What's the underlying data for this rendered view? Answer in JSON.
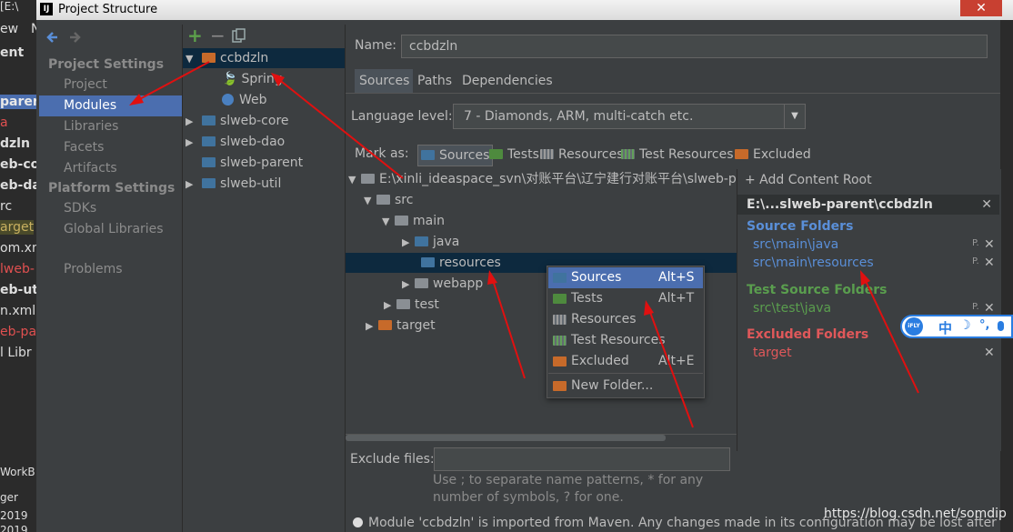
{
  "window": {
    "title": "Project Structure",
    "close_glyph": "✕",
    "app_icon": "IJ"
  },
  "background_ide": {
    "rows": [
      "[E:\\",
      "ew",
      "ent",
      "parer",
      "a",
      "dzln",
      "eb-co",
      "eb-da",
      "rc",
      "arget",
      "om.xn",
      "lweb-",
      "eb-uti",
      "n.xml",
      "eb-pa",
      "l Libr",
      "WorkB",
      "ger",
      "2019",
      "2019"
    ],
    "tab_label": "N"
  },
  "nav": {
    "back_icon": "arrow-left-icon",
    "forward_icon": "arrow-right-icon",
    "project_settings_header": "Project Settings",
    "project_settings": [
      "Project",
      "Modules",
      "Libraries",
      "Facets",
      "Artifacts"
    ],
    "platform_settings_header": "Platform Settings",
    "platform_settings": [
      "SDKs",
      "Global Libraries"
    ],
    "problems": "Problems",
    "selected": "Modules"
  },
  "modules": {
    "toolbar": [
      "add-icon",
      "remove-icon",
      "copy-icon"
    ],
    "add_glyph": "+",
    "remove_glyph": "−",
    "tree": [
      {
        "label": "ccbdzln",
        "expanded": true,
        "selected": true
      },
      {
        "label": "Spring",
        "child": true
      },
      {
        "label": "Web",
        "child": true
      },
      {
        "label": "slweb-core",
        "expanded": false
      },
      {
        "label": "slweb-dao",
        "expanded": false
      },
      {
        "label": "slweb-parent",
        "expanded": false
      },
      {
        "label": "slweb-util",
        "expanded": false
      }
    ]
  },
  "details": {
    "name_label": "Name:",
    "name_value": "ccbdzln",
    "tabs": [
      "Sources",
      "Paths",
      "Dependencies"
    ],
    "active_tab": "Sources",
    "language_level_label": "Language level:",
    "language_level_value": "7 - Diamonds, ARM, multi-catch etc.",
    "mark_as_label": "Mark as:",
    "mark_as": [
      "Sources",
      "Tests",
      "Resources",
      "Test Resources",
      "Excluded"
    ],
    "content_tree": {
      "root": "E:\\xinli_ideaspace_svn\\对账平台\\辽宁建行对账平台\\slweb-parent\\ccbdzln",
      "src": "src",
      "main": "main",
      "java": "java",
      "resources": "resources",
      "webapp": "webapp",
      "test": "test",
      "target": "target"
    },
    "exclude_files_label": "Exclude files:",
    "exclude_files_value": "",
    "exclude_hint_line1": "Use ; to separate name patterns, * for any",
    "exclude_hint_line2": "number of symbols, ? for one.",
    "status_message": "Module 'ccbdzln' is imported from Maven. Any changes made in its configuration may be lost after"
  },
  "content_root_panel": {
    "add_label": "+ Add Content Root",
    "root_header": "E:\\...slweb-parent\\ccbdzln",
    "source_folders_title": "Source Folders",
    "source_folders": [
      "src\\main\\java",
      "src\\main\\resources"
    ],
    "test_source_folders_title": "Test Source Folders",
    "test_source_folders": [
      "src\\test\\java"
    ],
    "excluded_folders_title": "Excluded Folders",
    "excluded_folders": [
      "target"
    ],
    "props_glyph": "P.",
    "remove_glyph": "✕",
    "colors": {
      "source": "#5a8fd8",
      "test": "#5a9e4e",
      "excluded": "#e0585a"
    }
  },
  "context_menu": {
    "items": [
      {
        "label": "Sources",
        "shortcut": "Alt+S",
        "selected": true
      },
      {
        "label": "Tests",
        "shortcut": "Alt+T"
      },
      {
        "label": "Resources",
        "shortcut": ""
      },
      {
        "label": "Test Resources",
        "shortcut": ""
      },
      {
        "label": "Excluded",
        "shortcut": "Alt+E"
      },
      {
        "label": "New Folder...",
        "shortcut": ""
      }
    ]
  },
  "ifly_toolbar": {
    "brand": "iFLY",
    "items": [
      "中",
      "☽",
      "°,",
      "🎤"
    ]
  },
  "watermark": "https://blog.csdn.net/somdip"
}
